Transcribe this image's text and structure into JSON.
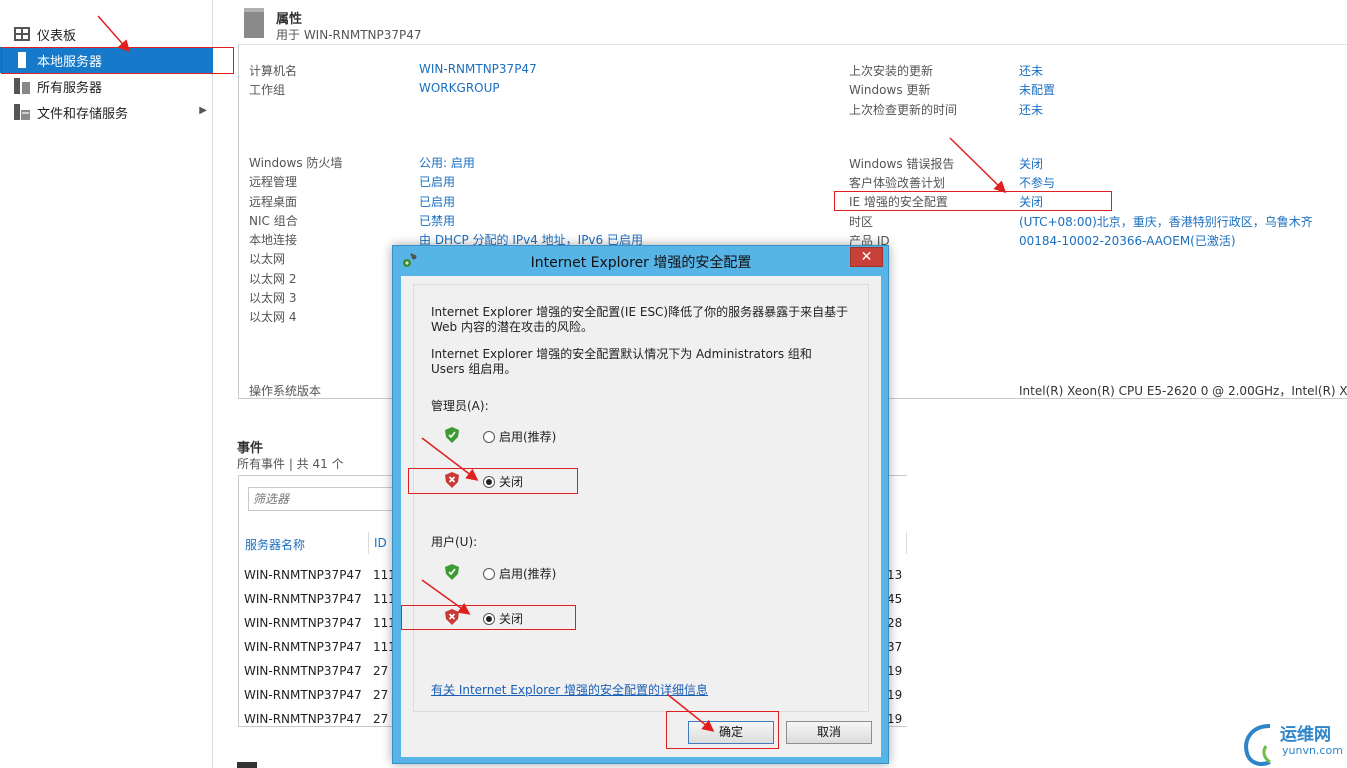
{
  "sidebar": {
    "items": [
      {
        "label": "仪表板",
        "icon": "dashboard-icon"
      },
      {
        "label": "本地服务器",
        "icon": "server-icon",
        "selected": true
      },
      {
        "label": "所有服务器",
        "icon": "servers-icon"
      },
      {
        "label": "文件和存储服务",
        "icon": "storage-icon",
        "has_submenu": true
      }
    ]
  },
  "properties": {
    "title": "属性",
    "subtitle": "用于 WIN-RNMTNP37P47",
    "left": [
      {
        "label": "计算机名",
        "value": "WIN-RNMTNP37P47"
      },
      {
        "label": "工作组",
        "value": "WORKGROUP"
      },
      {
        "label": "Windows 防火墙",
        "value": "公用: 启用"
      },
      {
        "label": "远程管理",
        "value": "已启用"
      },
      {
        "label": "远程桌面",
        "value": "已启用"
      },
      {
        "label": "NIC 组合",
        "value": "已禁用"
      },
      {
        "label": "本地连接",
        "value": "由 DHCP 分配的 IPv4 地址，IPv6 已启用"
      },
      {
        "label": "以太网",
        "value": ""
      },
      {
        "label": "以太网 2",
        "value": ""
      },
      {
        "label": "以太网 3",
        "value": ""
      },
      {
        "label": "以太网 4",
        "value": ""
      },
      {
        "label": "操作系统版本",
        "value": ""
      }
    ],
    "right": [
      {
        "label": "上次安装的更新",
        "value": "还未"
      },
      {
        "label": "Windows 更新",
        "value": "未配置"
      },
      {
        "label": "上次检查更新的时间",
        "value": "还未"
      },
      {
        "label": "Windows 错误报告",
        "value": "关闭"
      },
      {
        "label": "客户体验改善计划",
        "value": "不参与"
      },
      {
        "label": "IE 增强的安全配置",
        "value": "关闭"
      },
      {
        "label": "时区",
        "value": "(UTC+08:00)北京，重庆，香港特别行政区，乌鲁木齐"
      },
      {
        "label": "产品 ID",
        "value": "00184-10002-20366-AAOEM(已激活)"
      }
    ],
    "cpu": "Intel(R) Xeon(R) CPU E5-2620 0 @ 2.00GHz，Intel(R) Xeon"
  },
  "events": {
    "title": "事件",
    "subtitle": "所有事件 | 共 41 个",
    "filter_placeholder": "筛选器",
    "columns": [
      "服务器名称",
      "ID"
    ],
    "rows": [
      {
        "server": "WIN-RNMTNP37P47",
        "id": "111",
        "extra": "13"
      },
      {
        "server": "WIN-RNMTNP37P47",
        "id": "111",
        "extra": "45"
      },
      {
        "server": "WIN-RNMTNP37P47",
        "id": "111",
        "extra": "28"
      },
      {
        "server": "WIN-RNMTNP37P47",
        "id": "111",
        "extra": "37"
      },
      {
        "server": "WIN-RNMTNP37P47",
        "id": "27",
        "extra": "19"
      },
      {
        "server": "WIN-RNMTNP37P47",
        "id": "27",
        "extra": "19"
      },
      {
        "server": "WIN-RNMTNP37P47",
        "id": "27",
        "extra": "19"
      }
    ]
  },
  "dialog": {
    "title": "Internet Explorer 增强的安全配置",
    "close_label": "✕",
    "desc1_line1": "Internet Explorer 增强的安全配置(IE ESC)降低了你的服务器暴露于来自基于",
    "desc1_line2": "Web 内容的潜在攻击的风险。",
    "desc2_line1": "Internet Explorer 增强的安全配置默认情况下为 Administrators 组和",
    "desc2_line2": "Users 组启用。",
    "admin_label": "管理员(A):",
    "user_label": "用户(U):",
    "on_label": "启用(推荐)",
    "off_label": "关闭",
    "admin_selected": "off",
    "user_selected": "off",
    "link": "有关 Internet Explorer 增强的安全配置的详细信息",
    "ok_label": "确定",
    "cancel_label": "取消"
  },
  "colors": {
    "accent": "#1679c9",
    "link": "#1a6fc0",
    "dialog_frame": "#57b4e7",
    "close_button": "#c8403a",
    "annotation": "#e02020"
  },
  "watermark": {
    "text": "运维网",
    "url": "yunvn.com"
  }
}
